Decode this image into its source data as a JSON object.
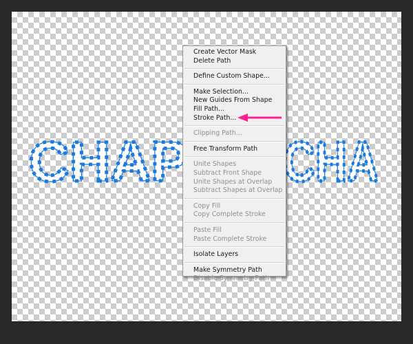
{
  "canvas_text": {
    "left": "CHAP",
    "right": "CHA"
  },
  "colors": {
    "path_blue": "#1a7ae0",
    "arrow_pink": "#ff1f8f",
    "workspace": "#282828"
  },
  "menu": {
    "groups": [
      [
        {
          "label": "Create Vector Mask",
          "enabled": true
        },
        {
          "label": "Delete Path",
          "enabled": true
        }
      ],
      [
        {
          "label": "Define Custom Shape...",
          "enabled": true
        }
      ],
      [
        {
          "label": "Make Selection...",
          "enabled": true
        },
        {
          "label": "New Guides From Shape",
          "enabled": true
        },
        {
          "label": "Fill Path...",
          "enabled": true
        },
        {
          "label": "Stroke Path...",
          "enabled": true
        }
      ],
      [
        {
          "label": "Clipping Path...",
          "enabled": false
        }
      ],
      [
        {
          "label": "Free Transform Path",
          "enabled": true
        }
      ],
      [
        {
          "label": "Unite Shapes",
          "enabled": false
        },
        {
          "label": "Subtract Front Shape",
          "enabled": false
        },
        {
          "label": "Unite Shapes at Overlap",
          "enabled": false
        },
        {
          "label": "Subtract Shapes at Overlap",
          "enabled": false
        }
      ],
      [
        {
          "label": "Copy Fill",
          "enabled": false
        },
        {
          "label": "Copy Complete Stroke",
          "enabled": false
        }
      ],
      [
        {
          "label": "Paste Fill",
          "enabled": false
        },
        {
          "label": "Paste Complete Stroke",
          "enabled": false
        }
      ],
      [
        {
          "label": "Isolate Layers",
          "enabled": true
        }
      ],
      [
        {
          "label": "Make Symmetry Path",
          "enabled": true
        },
        {
          "label": "Disable Symmetry Path",
          "enabled": false
        }
      ]
    ]
  },
  "annotation": {
    "points_to": "Stroke Path...",
    "icon": "arrow-left-icon"
  }
}
